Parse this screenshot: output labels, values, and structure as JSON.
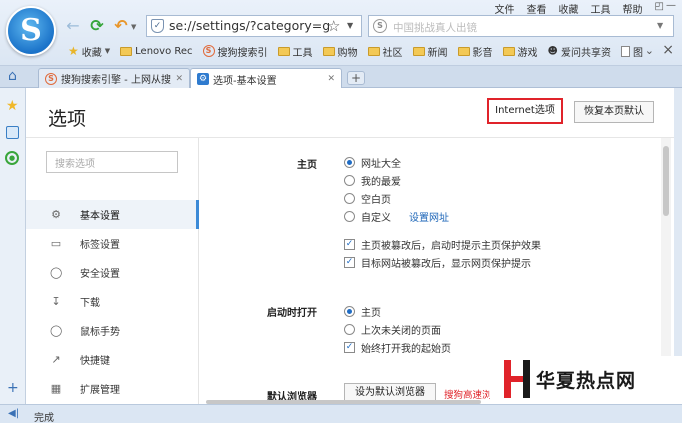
{
  "browser": {
    "logo_letter": "S",
    "address": "se://settings/?category=gen",
    "search_placeholder": "中国挑战真人出镜",
    "menus": [
      "文件",
      "查看",
      "收藏",
      "工具",
      "帮助"
    ],
    "bookmarks": {
      "favorites_label": "收藏",
      "items": [
        "Lenovo Rec",
        "搜狗搜索引",
        "工具",
        "购物",
        "社区",
        "新闻",
        "影音",
        "游戏",
        "爱问共享资",
        "图"
      ]
    },
    "tabs": [
      {
        "label": "搜狗搜索引擎 - 上网从搜",
        "active": false
      },
      {
        "label": "选项-基本设置",
        "active": true
      }
    ],
    "status": "完成"
  },
  "settings": {
    "title": "选项",
    "internet_options_label": "Internet选项",
    "restore_default_label": "恢复本页默认",
    "search_placeholder": "搜索选项",
    "sidebar": [
      {
        "icon": "gear-icon",
        "label": "基本设置",
        "active": true
      },
      {
        "icon": "tab-icon",
        "label": "标签设置"
      },
      {
        "icon": "shield-icon",
        "label": "安全设置"
      },
      {
        "icon": "download-icon",
        "label": "下载"
      },
      {
        "icon": "mouse-icon",
        "label": "鼠标手势"
      },
      {
        "icon": "shortcut-icon",
        "label": "快捷键"
      },
      {
        "icon": "extension-icon",
        "label": "扩展管理"
      }
    ],
    "homepage": {
      "label": "主页",
      "options": [
        "网址大全",
        "我的最爱",
        "空白页",
        "自定义"
      ],
      "selected": 0,
      "set_url_link": "设置网址",
      "checks": [
        {
          "label": "主页被篡改后，启动时提示主页保护效果",
          "checked": true
        },
        {
          "label": "目标网站被篡改后，显示网页保护提示",
          "checked": true
        }
      ]
    },
    "startup": {
      "label": "启动时打开",
      "options": [
        "主页",
        "上次未关闭的页面"
      ],
      "selected": 0,
      "check": {
        "label": "始终打开我的起始页",
        "checked": true
      }
    },
    "default_browser": {
      "label": "默认浏览器",
      "button": "设为默认浏览器",
      "note": "搜狗高速浏览器"
    }
  },
  "watermark": {
    "text": "华夏热点网"
  },
  "colors": {
    "accent": "#3c8ad7",
    "highlight_border": "#e0232a"
  }
}
